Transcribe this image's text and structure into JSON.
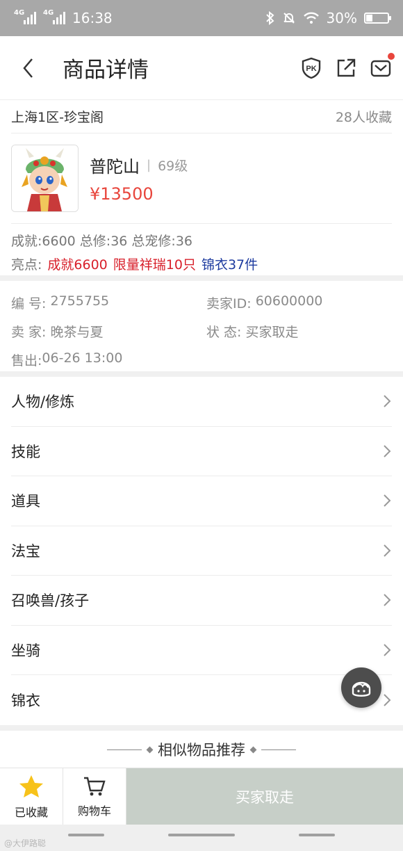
{
  "status_bar": {
    "signal1": "4G",
    "signal2": "4G",
    "time": "16:38",
    "battery": "30%",
    "battery_level": 0.3
  },
  "header": {
    "title": "商品详情"
  },
  "server": {
    "name": "上海1区-珍宝阁",
    "favorites": "28人收藏"
  },
  "product": {
    "name": "普陀山",
    "separator": "|",
    "level": "69级",
    "price": "¥13500"
  },
  "stats": "成就:6600 总修:36 总宠修:36",
  "highlights": {
    "label": "亮点:",
    "items": [
      {
        "text": "成就6600",
        "color": "#d8202b"
      },
      {
        "text": "限量祥瑞10只",
        "color": "#d8202b"
      },
      {
        "text": "锦衣37件",
        "color": "#1d3b9f"
      }
    ]
  },
  "details": {
    "number_label": "编  号:",
    "number_value": "2755755",
    "seller_id_label": "卖家ID:",
    "seller_id_value": "60600000",
    "seller_label": "卖  家:",
    "seller_value": "晚茶与夏",
    "status_label": "状  态:",
    "status_value": "买家取走",
    "sold_label": "售出:",
    "sold_value": "06-26 13:00"
  },
  "menu": [
    {
      "label": "人物/修炼"
    },
    {
      "label": "技能"
    },
    {
      "label": "道具"
    },
    {
      "label": "法宝"
    },
    {
      "label": "召唤兽/孩子"
    },
    {
      "label": "坐骑"
    },
    {
      "label": "锦衣"
    }
  ],
  "recommend": {
    "title": "相似物品推荐"
  },
  "bottom_bar": {
    "favorited_label": "已收藏",
    "cart_label": "购物车",
    "buy_label": "买家取走"
  },
  "watermark": "@大伊路聪",
  "colors": {
    "accent": "#e8453c",
    "star": "#f7c21a",
    "buy_disabled": "#c7cfc8"
  }
}
